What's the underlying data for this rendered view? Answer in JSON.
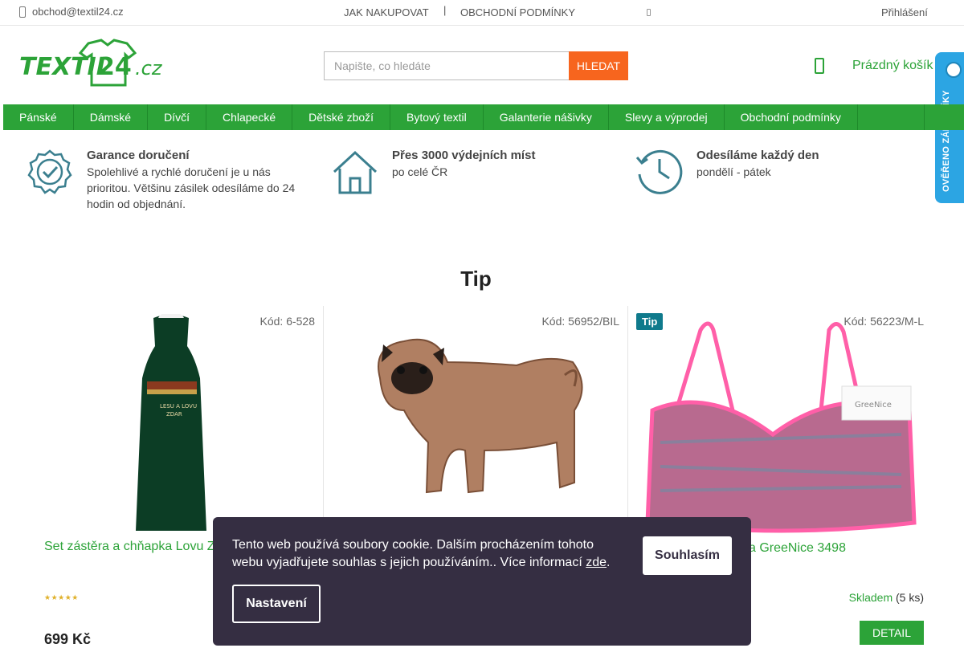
{
  "topbar": {
    "email": "obchod@textil24.cz",
    "how_to_buy": "JAK NAKUPOVAT",
    "separator": "|",
    "terms": "OBCHODNÍ PODMÍNKY",
    "login": "Přihlášení"
  },
  "header": {
    "logo_text": "TEXTIL24.cz",
    "search_placeholder": "Napište, co hledáte",
    "search_button": "HLEDAT",
    "cart_label": "Prázdný košík"
  },
  "badge": {
    "text": "OVĚŘENO ZÁKAZNÍKY"
  },
  "nav": [
    "Pánské",
    "Dámské",
    "Dívčí",
    "Chlapecké",
    "Dětské zboží",
    "Bytový textil",
    "Galanterie nášivky",
    "Slevy a výprodej",
    "Obchodní podmínky"
  ],
  "benefits": [
    {
      "title": "Garance doručení",
      "desc": "Spolehlivé a rychlé doručení je u nás prioritou. Většinu zásilek odesíláme do 24 hodin od objednání.",
      "icon": "badge-check-icon"
    },
    {
      "title": "Přes 3000 výdejních míst",
      "desc": "po celé ČR",
      "icon": "house-icon"
    },
    {
      "title": "Odesíláme každý den",
      "desc": "pondělí - pátek",
      "icon": "clock-icon"
    }
  ],
  "section": {
    "title": "Tip"
  },
  "products": [
    {
      "code": "Kód: 6-528",
      "name": "Set zástěra a chňapka Lovu Zdar",
      "price": "699 Kč",
      "stars": "★★★★★",
      "tip": ""
    },
    {
      "code": "Kód: 56952/BIL",
      "name": "",
      "tip": ""
    },
    {
      "code": "Kód: 56223/M-L",
      "name": "a GreeNice 3498",
      "tip": "Tip",
      "stock": "Skladem",
      "stock_qty": "(5 ks)",
      "detail": "DETAIL"
    }
  ],
  "cookie": {
    "text": "Tento web používá soubory cookie. Dalším procházením tohoto webu vyjadřujete souhlas s jejich používáním.. Více informací ",
    "link": "zde",
    "period": ".",
    "accept": "Souhlasím",
    "settings": "Nastavení"
  },
  "colors": {
    "green": "#2ca338",
    "orange": "#f7651e",
    "cookie_bg": "#352e42",
    "teal": "#0f7a8c",
    "badge_blue": "#2ca5e3"
  }
}
